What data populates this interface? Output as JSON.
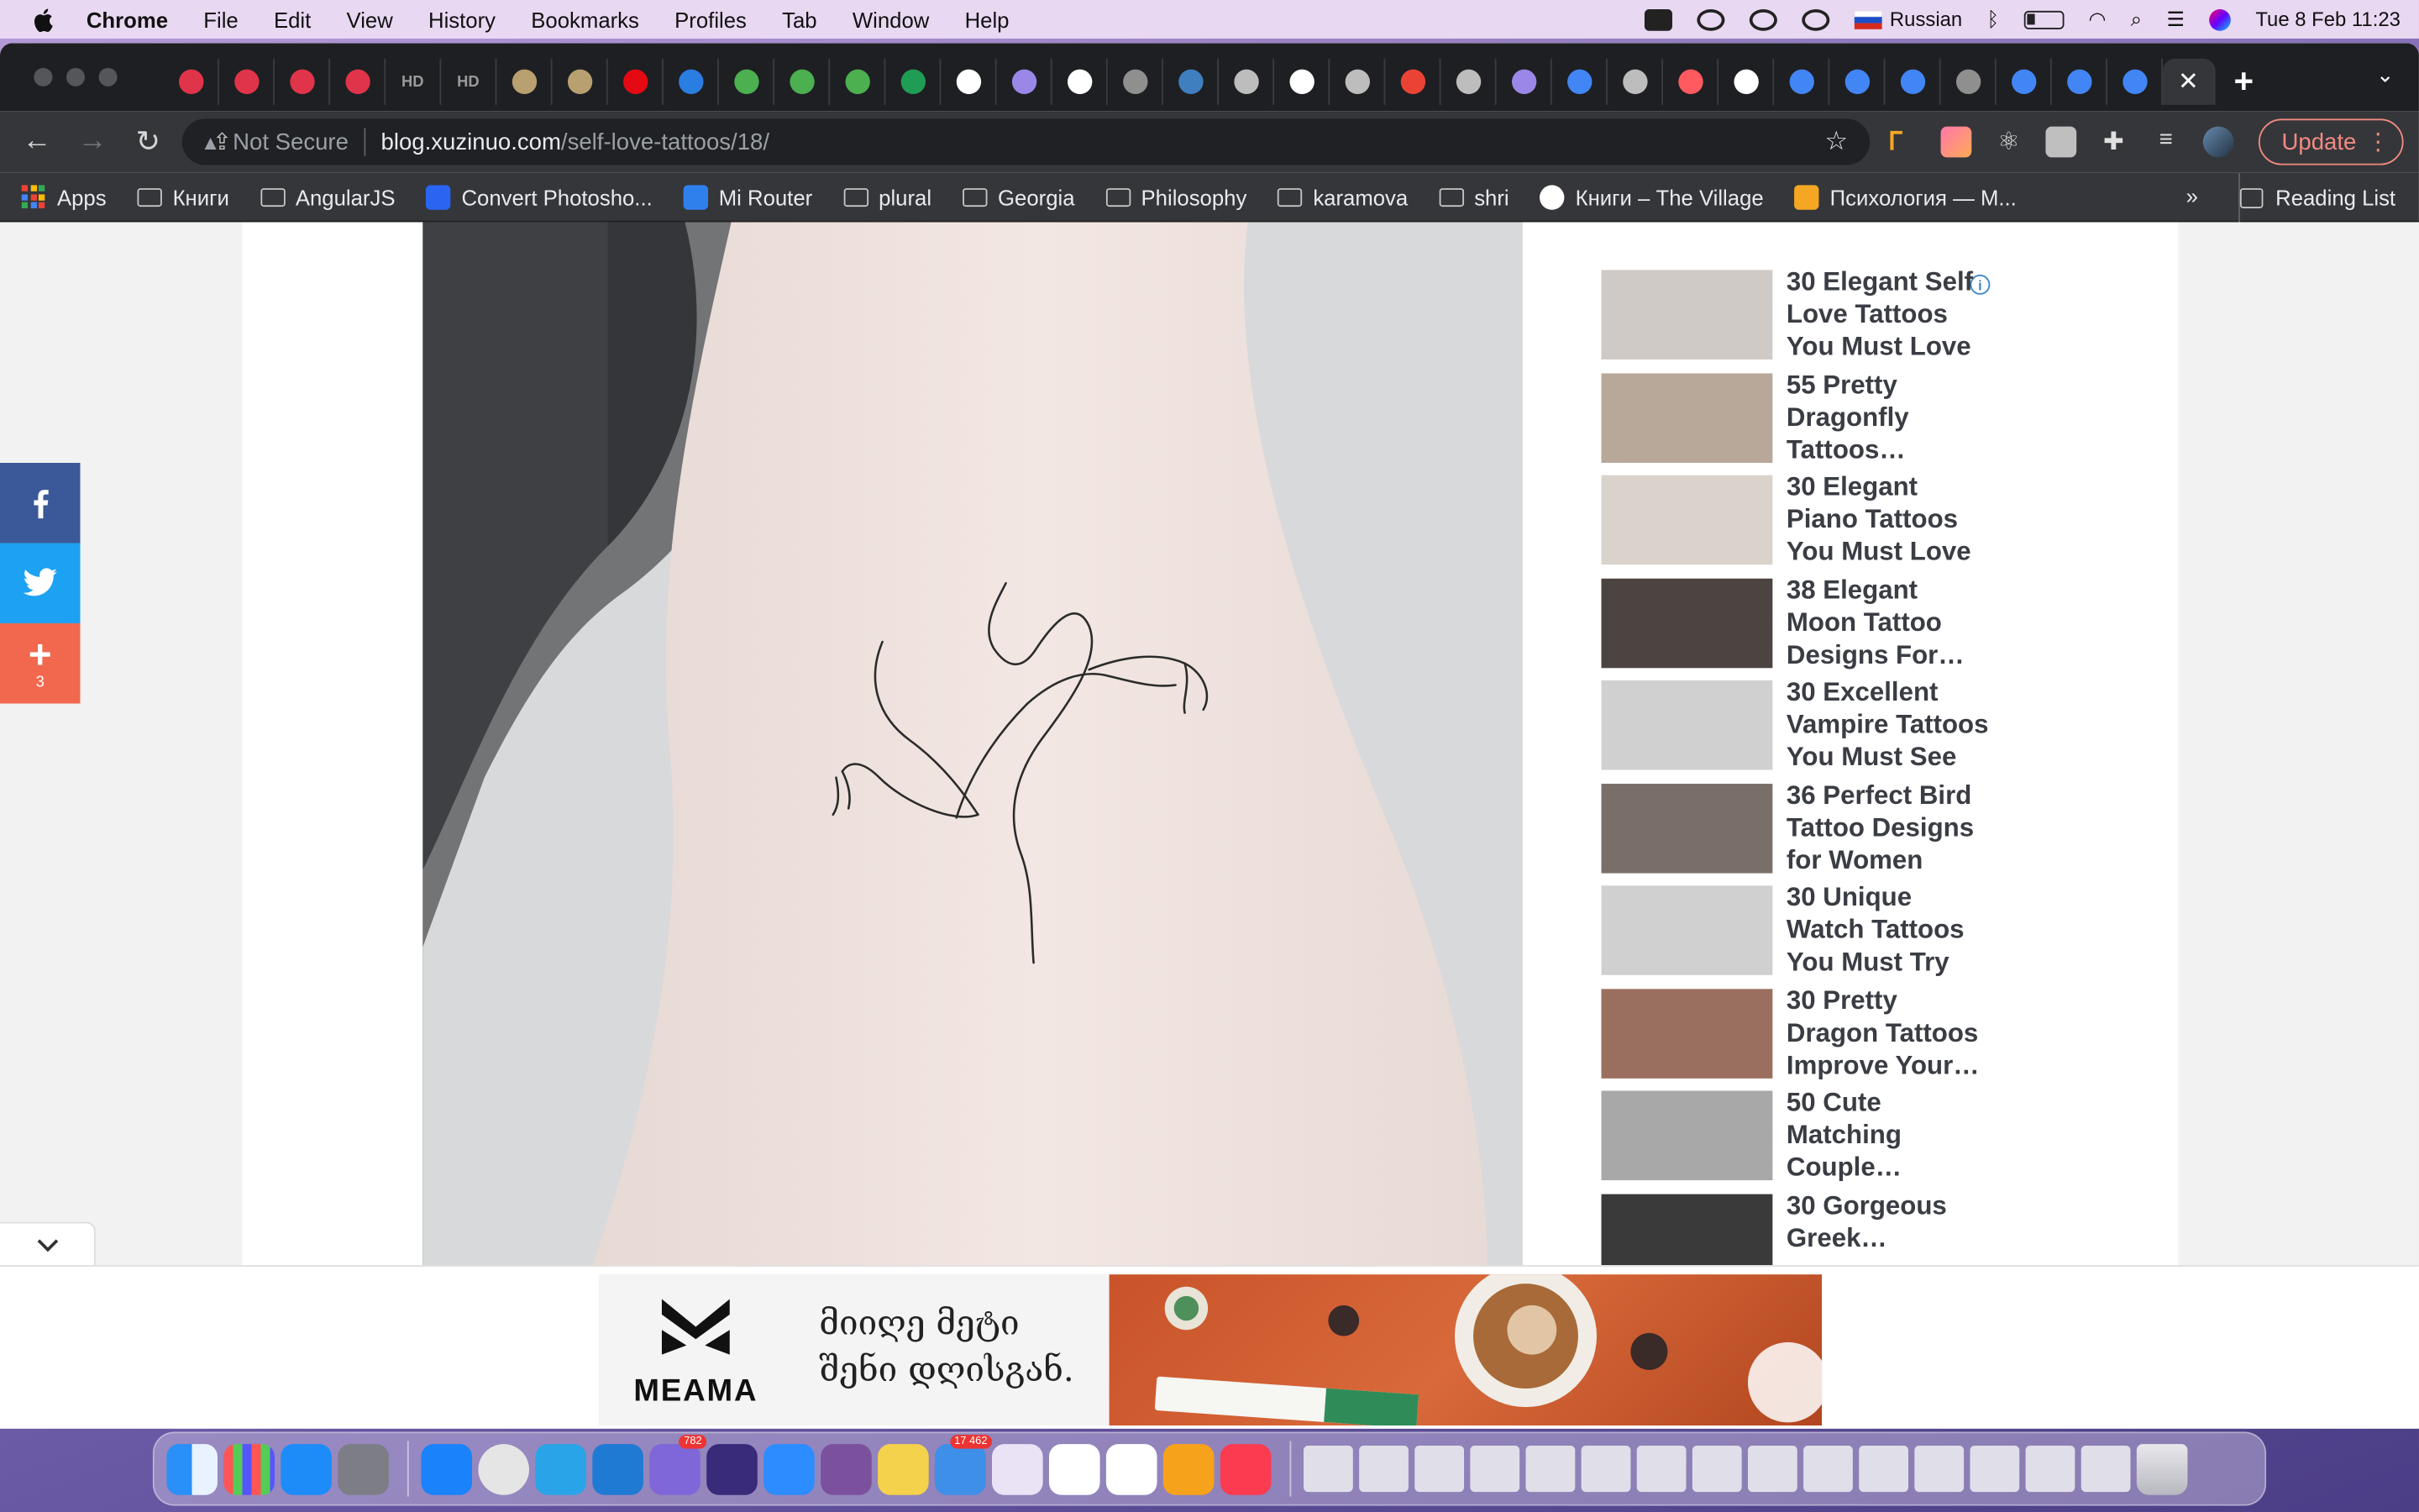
{
  "menubar": {
    "app_name": "Chrome",
    "items": [
      "File",
      "Edit",
      "View",
      "History",
      "Bookmarks",
      "Profiles",
      "Tab",
      "Window",
      "Help"
    ],
    "input_source": "Russian",
    "datetime": "Tue 8 Feb  11:23"
  },
  "tabs": {
    "favicons": [
      "#e0344a",
      "#e0344a",
      "#e0344a",
      "#e0344a",
      "#6b6b6b",
      "#6b6b6b",
      "#b8a070",
      "#b8a070",
      "#e50914",
      "#2a7de1",
      "#4caf50",
      "#4caf50",
      "#4caf50",
      "#1f9d55",
      "#ffffff",
      "#9b87e8",
      "#ffffff",
      "#8f8f8f",
      "#3f7fbf",
      "#bdbdbd",
      "#ffffff",
      "#bdbdbd",
      "#ea4335",
      "#bdbdbd",
      "#9b87e8",
      "#4285f4",
      "#bdbdbd",
      "#ff5a5f",
      "#ffffff",
      "#4285f4",
      "#4285f4",
      "#4285f4",
      "#8f8f8f",
      "#4285f4",
      "#4285f4",
      "#4285f4"
    ],
    "hd_label": "HD",
    "active_close": "✕",
    "new_tab": "+"
  },
  "toolbar": {
    "security": "Not Secure",
    "url_host": "blog.xuzinuo.com",
    "url_path": "/self-love-tattoos/18/",
    "update_label": "Update"
  },
  "bookmarks": {
    "apps_label": "Apps",
    "items": [
      "Книги",
      "AngularJS",
      "Convert Photosho...",
      "Mi Router",
      "plural",
      "Georgia",
      "Philosophy",
      "karamova",
      "shri",
      "Книги – The Village",
      "Психология — М..."
    ],
    "more": "»",
    "reading_list": "Reading List"
  },
  "share": {
    "plus_count": "3"
  },
  "sidebar_ads": [
    {
      "title": "30 Elegant Self Love Tattoos You Must Love",
      "thumb": "#cfcac6"
    },
    {
      "title": "55 Pretty Dragonfly Tattoos…",
      "thumb": "#b8a89a"
    },
    {
      "title": "30 Elegant Piano Tattoos You Must Love",
      "thumb": "#d9d3cc"
    },
    {
      "title": "38 Elegant Moon Tattoo Designs For…",
      "thumb": "#4c4440"
    },
    {
      "title": "30 Excellent Vampire Tattoos You Must See",
      "thumb": "#d0d0d0"
    },
    {
      "title": "36 Perfect Bird Tattoo Designs for Women",
      "thumb": "#7a6f68"
    },
    {
      "title": "30 Unique Watch Tattoos You Must Try",
      "thumb": "#d0d0d0"
    },
    {
      "title": "30 Pretty Dragon Tattoos Improve Your…",
      "thumb": "#9b6f5f"
    },
    {
      "title": "50 Cute Matching Couple…",
      "thumb": "#a8a8a8"
    },
    {
      "title": "30 Gorgeous Greek…",
      "thumb": "#3a3a3a"
    }
  ],
  "banner": {
    "brand": "MEAMA",
    "line1": "მიიღე მეტი",
    "line2": "შენი დღისგან."
  },
  "dock": {
    "apps": [
      "#1f6fe0",
      "#6e6e7a",
      "#1d8cf8",
      "#7d7d85",
      "#1a82fb",
      "#e5e5e5",
      "#2aa4e8",
      "#1f7ad4",
      "#7f66d9",
      "#3a2a7a",
      "#2d8cff",
      "#7b519d",
      "#f5d24b",
      "#3d8fe8",
      "#e9e3f5",
      "#ffffff",
      "#ffffff",
      "#f7a21b",
      "#fb3b50"
    ],
    "badges": {
      "8": "782",
      "13": "17 462"
    }
  }
}
